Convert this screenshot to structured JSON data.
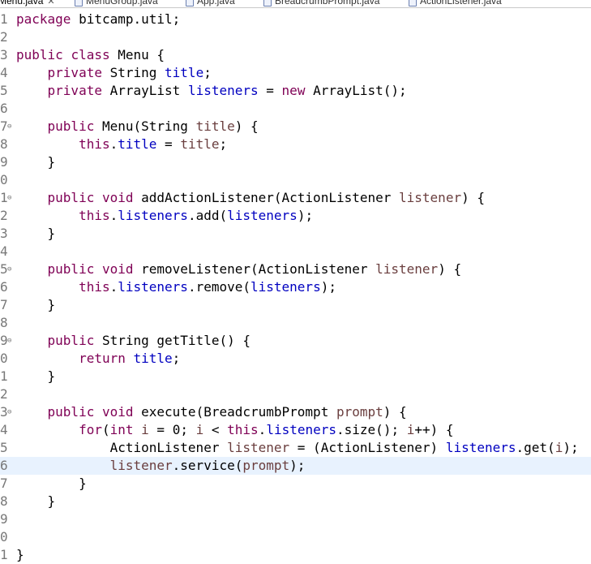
{
  "tabs": [
    {
      "label": "Menu.java",
      "close": "✕",
      "active": true
    },
    {
      "label": "MenuGroup.java",
      "active": false
    },
    {
      "label": "App.java",
      "active": false
    },
    {
      "label": "BreadcrumbPrompt.java",
      "active": false
    },
    {
      "label": "ActionListener.java",
      "active": false
    }
  ],
  "editor": {
    "current_line": 26,
    "lines": [
      {
        "ln": "1",
        "tokens": [
          [
            "kw",
            "package"
          ],
          [
            "t",
            " bitcamp.util;"
          ]
        ]
      },
      {
        "ln": "2",
        "tokens": []
      },
      {
        "ln": "3",
        "tokens": [
          [
            "kw",
            "public"
          ],
          [
            "t",
            " "
          ],
          [
            "kw",
            "class"
          ],
          [
            "t",
            " Menu {"
          ]
        ]
      },
      {
        "ln": "4",
        "tokens": [
          [
            "t",
            "    "
          ],
          [
            "kw",
            "private"
          ],
          [
            "t",
            " String "
          ],
          [
            "fld",
            "title"
          ],
          [
            "t",
            ";"
          ]
        ]
      },
      {
        "ln": "5",
        "tokens": [
          [
            "t",
            "    "
          ],
          [
            "kw",
            "private"
          ],
          [
            "t",
            " ArrayList "
          ],
          [
            "fld",
            "listeners"
          ],
          [
            "t",
            " = "
          ],
          [
            "kw",
            "new"
          ],
          [
            "t",
            " ArrayList();"
          ]
        ]
      },
      {
        "ln": "6",
        "tokens": []
      },
      {
        "ln": "7",
        "fold": "⊖",
        "tokens": [
          [
            "t",
            "    "
          ],
          [
            "kw",
            "public"
          ],
          [
            "t",
            " Menu(String "
          ],
          [
            "par",
            "title"
          ],
          [
            "t",
            ") {"
          ]
        ]
      },
      {
        "ln": "8",
        "tokens": [
          [
            "t",
            "        "
          ],
          [
            "kw",
            "this"
          ],
          [
            "t",
            "."
          ],
          [
            "fld",
            "title"
          ],
          [
            "t",
            " = "
          ],
          [
            "par",
            "title"
          ],
          [
            "t",
            ";"
          ]
        ]
      },
      {
        "ln": "9",
        "tokens": [
          [
            "t",
            "    }"
          ]
        ]
      },
      {
        "ln": "0",
        "tokens": []
      },
      {
        "ln": "1",
        "fold": "⊖",
        "tokens": [
          [
            "t",
            "    "
          ],
          [
            "kw",
            "public"
          ],
          [
            "t",
            " "
          ],
          [
            "kw",
            "void"
          ],
          [
            "t",
            " addActionListener(ActionListener "
          ],
          [
            "par",
            "listener"
          ],
          [
            "t",
            ") {"
          ]
        ]
      },
      {
        "ln": "2",
        "tokens": [
          [
            "t",
            "        "
          ],
          [
            "kw",
            "this"
          ],
          [
            "t",
            "."
          ],
          [
            "fld",
            "listeners"
          ],
          [
            "t",
            ".add("
          ],
          [
            "fld",
            "listeners"
          ],
          [
            "t",
            ");"
          ]
        ]
      },
      {
        "ln": "3",
        "tokens": [
          [
            "t",
            "    }"
          ]
        ]
      },
      {
        "ln": "4",
        "tokens": []
      },
      {
        "ln": "5",
        "fold": "⊖",
        "tokens": [
          [
            "t",
            "    "
          ],
          [
            "kw",
            "public"
          ],
          [
            "t",
            " "
          ],
          [
            "kw",
            "void"
          ],
          [
            "t",
            " removeListener(ActionListener "
          ],
          [
            "par",
            "listener"
          ],
          [
            "t",
            ") {"
          ]
        ]
      },
      {
        "ln": "6",
        "tokens": [
          [
            "t",
            "        "
          ],
          [
            "kw",
            "this"
          ],
          [
            "t",
            "."
          ],
          [
            "fld",
            "listeners"
          ],
          [
            "t",
            ".remove("
          ],
          [
            "fld",
            "listeners"
          ],
          [
            "t",
            ");"
          ]
        ]
      },
      {
        "ln": "7",
        "tokens": [
          [
            "t",
            "    }"
          ]
        ]
      },
      {
        "ln": "8",
        "tokens": []
      },
      {
        "ln": "9",
        "fold": "⊖",
        "tokens": [
          [
            "t",
            "    "
          ],
          [
            "kw",
            "public"
          ],
          [
            "t",
            " String getTitle() {"
          ]
        ]
      },
      {
        "ln": "0",
        "tokens": [
          [
            "t",
            "        "
          ],
          [
            "kw",
            "return"
          ],
          [
            "t",
            " "
          ],
          [
            "fld",
            "title"
          ],
          [
            "t",
            ";"
          ]
        ]
      },
      {
        "ln": "1",
        "tokens": [
          [
            "t",
            "    }"
          ]
        ]
      },
      {
        "ln": "2",
        "tokens": []
      },
      {
        "ln": "3",
        "fold": "⊖",
        "tokens": [
          [
            "t",
            "    "
          ],
          [
            "kw",
            "public"
          ],
          [
            "t",
            " "
          ],
          [
            "kw",
            "void"
          ],
          [
            "t",
            " execute(BreadcrumbPrompt "
          ],
          [
            "par",
            "prompt"
          ],
          [
            "t",
            ") {"
          ]
        ]
      },
      {
        "ln": "4",
        "tokens": [
          [
            "t",
            "        "
          ],
          [
            "kw",
            "for"
          ],
          [
            "t",
            "("
          ],
          [
            "kw",
            "int"
          ],
          [
            "t",
            " "
          ],
          [
            "loc",
            "i"
          ],
          [
            "t",
            " = 0; "
          ],
          [
            "loc",
            "i"
          ],
          [
            "t",
            " < "
          ],
          [
            "kw",
            "this"
          ],
          [
            "t",
            "."
          ],
          [
            "fld",
            "listeners"
          ],
          [
            "t",
            ".size(); "
          ],
          [
            "loc",
            "i"
          ],
          [
            "t",
            "++) {"
          ]
        ]
      },
      {
        "ln": "5",
        "tokens": [
          [
            "t",
            "            ActionListener "
          ],
          [
            "loc",
            "listener"
          ],
          [
            "t",
            " = (ActionListener) "
          ],
          [
            "fld",
            "listeners"
          ],
          [
            "t",
            ".get("
          ],
          [
            "loc",
            "i"
          ],
          [
            "t",
            ");"
          ]
        ]
      },
      {
        "ln": "6",
        "tokens": [
          [
            "t",
            "            "
          ],
          [
            "loc",
            "listener"
          ],
          [
            "t",
            ".service("
          ],
          [
            "par",
            "prompt"
          ],
          [
            "t",
            ");"
          ]
        ]
      },
      {
        "ln": "7",
        "tokens": [
          [
            "t",
            "        }"
          ]
        ]
      },
      {
        "ln": "8",
        "tokens": [
          [
            "t",
            "    }"
          ]
        ]
      },
      {
        "ln": "9",
        "tokens": []
      },
      {
        "ln": "0",
        "tokens": []
      },
      {
        "ln": "1",
        "tokens": [
          [
            "t",
            "}"
          ]
        ]
      }
    ]
  }
}
